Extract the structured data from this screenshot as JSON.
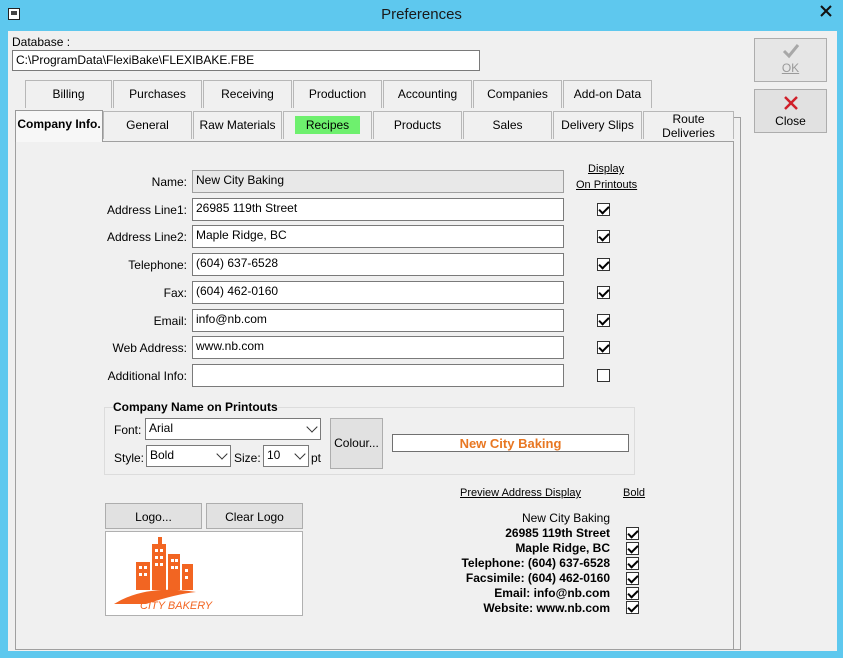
{
  "window": {
    "title": "Preferences"
  },
  "database": {
    "label": "Database :",
    "path": "C:\\ProgramData\\FlexiBake\\FLEXIBAKE.FBE"
  },
  "buttons": {
    "ok": "OK",
    "close": "Close",
    "logo": "Logo...",
    "clear_logo": "Clear Logo",
    "colour": "Colour..."
  },
  "tabs_row1": [
    "Billing",
    "Purchases",
    "Receiving",
    "Production",
    "Accounting",
    "Companies",
    "Add-on Data"
  ],
  "tabs_row2": [
    "Company Info.",
    "General",
    "Raw Materials",
    "Recipes",
    "Products",
    "Sales",
    "Delivery Slips",
    "Route\nDeliveries"
  ],
  "display_header": {
    "line1": "Display",
    "line2": "On Printouts"
  },
  "fields": [
    {
      "label": "Name:",
      "value": "New City Baking",
      "readonly": true
    },
    {
      "label": "Address Line1:",
      "value": "26985 119th Street",
      "checked": true
    },
    {
      "label": "Address Line2:",
      "value": "Maple Ridge, BC",
      "checked": true
    },
    {
      "label": "Telephone:",
      "value": "(604) 637-6528",
      "checked": true
    },
    {
      "label": "Fax:",
      "value": "(604) 462-0160",
      "checked": true
    },
    {
      "label": "Email:",
      "value": "info@nb.com",
      "checked": true
    },
    {
      "label": "Web Address:",
      "value": "www.nb.com",
      "checked": true
    },
    {
      "label": "Additional Info:",
      "value": "",
      "checked": false
    }
  ],
  "printout_group": {
    "title": "Company Name on Printouts",
    "font_label": "Font:",
    "font_value": "Arial",
    "style_label": "Style:",
    "style_value": "Bold",
    "size_label": "Size:",
    "size_value": "10",
    "size_unit": "pt",
    "preview_text": "New City Baking",
    "preview_color": "#e87722"
  },
  "logo": {
    "text": "CITY BAKERY",
    "color": "#f26522"
  },
  "preview": {
    "header": "Preview Address Display",
    "bold_header": "Bold",
    "lines": [
      {
        "text": "New City Baking",
        "bold": false,
        "checked": true
      },
      {
        "text": "26985 119th Street",
        "bold": true,
        "checked": true
      },
      {
        "text": "Maple Ridge, BC",
        "bold": true,
        "checked": true
      },
      {
        "text": "Telephone: (604) 637-6528",
        "bold": true,
        "checked": true
      },
      {
        "text": "Facsimile: (604) 462-0160",
        "bold": true,
        "checked": true
      },
      {
        "text": "Email: info@nb.com",
        "bold": true,
        "checked": true
      },
      {
        "text": "Website: www.nb.com",
        "bold": true,
        "checked": true
      }
    ]
  }
}
